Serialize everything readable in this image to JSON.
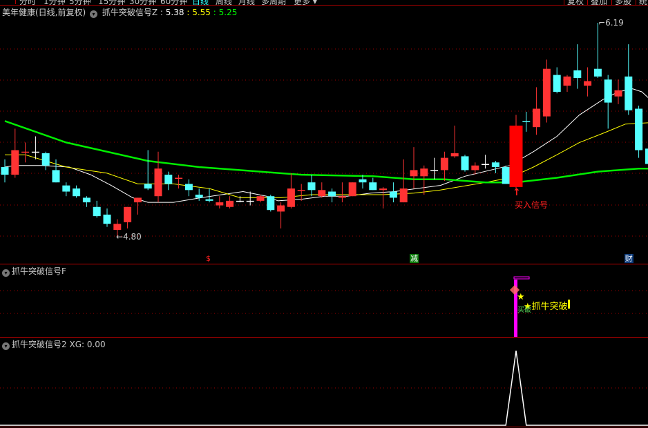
{
  "menu": {
    "items": [
      "分时",
      "1分钟",
      "5分钟",
      "15分钟",
      "30分钟",
      "60分钟",
      "日线",
      "周线",
      "月线",
      "多周期",
      "更多 ▾"
    ],
    "active_index": 6,
    "right_buttons": [
      "复权",
      "叠加",
      "多股",
      "统计"
    ]
  },
  "main_header": {
    "title": "美年健康(日线,前复权)",
    "indicator": "抓牛突破信号Z",
    "sep": ":",
    "v1": "5.38",
    "v2": "5.55",
    "v3": "5.25"
  },
  "panel2": {
    "title": "抓牛突破信号F",
    "signal_label": "★抓牛突破",
    "small_label": "买破"
  },
  "panel3": {
    "title": "抓牛突破信号2",
    "xg_label": "XG:",
    "xg_value": "0.00"
  },
  "annotations": {
    "high_label": "6.19",
    "low_label": "4.80",
    "buy_signal": "买入信号"
  },
  "event_tags": [
    {
      "text": "$",
      "index": 20,
      "color": "#ff2020",
      "bg": ""
    },
    {
      "text": "减",
      "index": 40,
      "color": "#ffffff",
      "bg": "#0a7a0a"
    },
    {
      "text": "财",
      "index": 61,
      "color": "#ffffff",
      "bg": "#0b3a7a"
    }
  ],
  "colors": {
    "up": "#ff3333",
    "down": "#54ffff",
    "flat": "#ffffff",
    "ma_short": "#ffffff",
    "ma_mid": "#ffff00",
    "ma_long": "#00ee00",
    "border": "#c00000",
    "signal_bar": "#ff00ff"
  },
  "chart_data": {
    "type": "candlestick",
    "title": "美年健康(日线,前复权)",
    "ylim": [
      4.8,
      6.19
    ],
    "grid": true,
    "candles_ohlc": [
      [
        5.25,
        5.3,
        5.15,
        5.2
      ],
      [
        5.2,
        5.5,
        5.18,
        5.36
      ],
      [
        5.35,
        5.41,
        5.28,
        5.35
      ],
      [
        5.35,
        5.45,
        5.3,
        5.35
      ],
      [
        5.34,
        5.35,
        5.23,
        5.26
      ],
      [
        5.23,
        5.3,
        5.15,
        5.15
      ],
      [
        5.13,
        5.15,
        5.06,
        5.09
      ],
      [
        5.11,
        5.13,
        5.05,
        5.06
      ],
      [
        5.05,
        5.06,
        4.99,
        5.02
      ],
      [
        4.99,
        5.03,
        4.92,
        4.93
      ],
      [
        4.94,
        4.98,
        4.86,
        4.88
      ],
      [
        4.84,
        4.91,
        4.8,
        4.88
      ],
      [
        4.89,
        4.99,
        4.85,
        4.99
      ],
      [
        5.02,
        5.05,
        4.94,
        5.05
      ],
      [
        5.14,
        5.36,
        5.1,
        5.11
      ],
      [
        5.06,
        5.35,
        5.02,
        5.24
      ],
      [
        5.2,
        5.22,
        5.1,
        5.14
      ],
      [
        5.18,
        5.2,
        5.11,
        5.18
      ],
      [
        5.14,
        5.17,
        5.06,
        5.1
      ],
      [
        5.07,
        5.11,
        5.03,
        5.05
      ],
      [
        5.04,
        5.11,
        5.02,
        5.03
      ],
      [
        5.0,
        5.06,
        4.98,
        5.02
      ],
      [
        4.99,
        5.06,
        4.98,
        5.03
      ],
      [
        5.03,
        5.06,
        5.02,
        5.03
      ],
      [
        5.03,
        5.09,
        5.0,
        5.03
      ],
      [
        5.03,
        5.07,
        5.02,
        5.06
      ],
      [
        5.06,
        5.07,
        4.96,
        4.97
      ],
      [
        4.96,
        5.02,
        4.85,
        5.0
      ],
      [
        4.99,
        5.21,
        4.98,
        5.11
      ],
      [
        5.1,
        5.14,
        5.03,
        5.1
      ],
      [
        5.15,
        5.2,
        5.06,
        5.1
      ],
      [
        5.06,
        5.15,
        5.05,
        5.1
      ],
      [
        5.09,
        5.11,
        5.02,
        5.06
      ],
      [
        5.05,
        5.15,
        5.02,
        5.06
      ],
      [
        5.06,
        5.15,
        5.06,
        5.15
      ],
      [
        5.17,
        5.2,
        5.11,
        5.15
      ],
      [
        5.15,
        5.18,
        5.1,
        5.1
      ],
      [
        5.1,
        5.12,
        4.98,
        5.11
      ],
      [
        5.09,
        5.15,
        5.02,
        5.05
      ],
      [
        5.02,
        5.3,
        5.02,
        5.11
      ],
      [
        5.19,
        5.38,
        5.11,
        5.23
      ],
      [
        5.19,
        5.26,
        5.07,
        5.24
      ],
      [
        5.23,
        5.31,
        5.17,
        5.23
      ],
      [
        5.23,
        5.35,
        5.16,
        5.31
      ],
      [
        5.32,
        5.52,
        5.31,
        5.34
      ],
      [
        5.32,
        5.33,
        5.22,
        5.23
      ],
      [
        5.23,
        5.28,
        5.2,
        5.26
      ],
      [
        5.27,
        5.33,
        5.24,
        5.27
      ],
      [
        5.28,
        5.29,
        5.21,
        5.25
      ],
      [
        5.25,
        5.26,
        5.14,
        5.14
      ],
      [
        5.12,
        5.59,
        5.11,
        5.52
      ],
      [
        5.55,
        5.61,
        5.48,
        5.55
      ],
      [
        5.51,
        5.77,
        5.46,
        5.63
      ],
      [
        5.58,
        5.95,
        5.54,
        5.89
      ],
      [
        5.85,
        5.9,
        5.73,
        5.74
      ],
      [
        5.78,
        5.85,
        5.74,
        5.84
      ],
      [
        5.88,
        6.05,
        5.76,
        5.83
      ],
      [
        5.78,
        5.9,
        5.71,
        5.81
      ],
      [
        5.89,
        6.19,
        5.83,
        5.84
      ],
      [
        5.82,
        5.85,
        5.5,
        5.67
      ],
      [
        5.71,
        5.82,
        5.66,
        5.75
      ],
      [
        5.84,
        6.05,
        5.59,
        5.62
      ],
      [
        5.63,
        5.65,
        5.31,
        5.36
      ],
      [
        5.37,
        5.38,
        5.25,
        5.27
      ]
    ],
    "ma_lines": [
      {
        "name": "short",
        "points": [
          [
            0,
            5.25
          ],
          [
            1,
            5.26
          ],
          [
            3.6,
            5.26
          ],
          [
            6.3,
            5.25
          ],
          [
            8.4,
            5.2
          ],
          [
            10.4,
            5.13
          ],
          [
            12.5,
            5.05
          ],
          [
            14,
            5.02
          ],
          [
            16.5,
            5.02
          ],
          [
            19.2,
            5.05
          ],
          [
            23.3,
            5.09
          ],
          [
            25.6,
            5.06
          ],
          [
            26.7,
            5.03
          ],
          [
            29,
            5.04
          ],
          [
            31.3,
            5.06
          ],
          [
            33.5,
            5.06
          ],
          [
            35.8,
            5.08
          ],
          [
            38.1,
            5.09
          ],
          [
            40.3,
            5.11
          ],
          [
            42.6,
            5.13
          ],
          [
            45,
            5.19
          ],
          [
            49.4,
            5.26
          ],
          [
            51.7,
            5.35
          ],
          [
            54,
            5.45
          ],
          [
            56.2,
            5.59
          ],
          [
            58.5,
            5.69
          ],
          [
            60,
            5.74
          ],
          [
            61.4,
            5.76
          ],
          [
            62.3,
            5.74
          ],
          [
            63.3,
            5.68
          ]
        ]
      },
      {
        "name": "mid",
        "points": [
          [
            0,
            5.33
          ],
          [
            2,
            5.33
          ],
          [
            4,
            5.29
          ],
          [
            6,
            5.25
          ],
          [
            10,
            5.21
          ],
          [
            13,
            5.14
          ],
          [
            16.5,
            5.14
          ],
          [
            20,
            5.11
          ],
          [
            23,
            5.05
          ],
          [
            27,
            5.05
          ],
          [
            30,
            5.07
          ],
          [
            33.5,
            5.07
          ],
          [
            37,
            5.07
          ],
          [
            40,
            5.08
          ],
          [
            42.6,
            5.1
          ],
          [
            47,
            5.15
          ],
          [
            49.4,
            5.18
          ],
          [
            51.7,
            5.25
          ],
          [
            54,
            5.33
          ],
          [
            56.2,
            5.41
          ],
          [
            58.5,
            5.47
          ],
          [
            60.7,
            5.53
          ],
          [
            63.3,
            5.54
          ]
        ]
      },
      {
        "name": "long",
        "points": [
          [
            0,
            5.55
          ],
          [
            6,
            5.41
          ],
          [
            14,
            5.29
          ],
          [
            19,
            5.25
          ],
          [
            29,
            5.2
          ],
          [
            36,
            5.19
          ],
          [
            40,
            5.17
          ],
          [
            43,
            5.17
          ],
          [
            47,
            5.15
          ],
          [
            50,
            5.15
          ],
          [
            54,
            5.18
          ],
          [
            58,
            5.22
          ],
          [
            62,
            5.24
          ],
          [
            63.3,
            5.24
          ]
        ]
      }
    ],
    "high": {
      "index": 58,
      "value": 6.19
    },
    "low": {
      "index": 11,
      "value": 4.8
    },
    "buy_signal_index": 50,
    "xg_series": {
      "name": "XG",
      "signal_index": 50,
      "ylim": [
        0,
        1
      ]
    }
  }
}
